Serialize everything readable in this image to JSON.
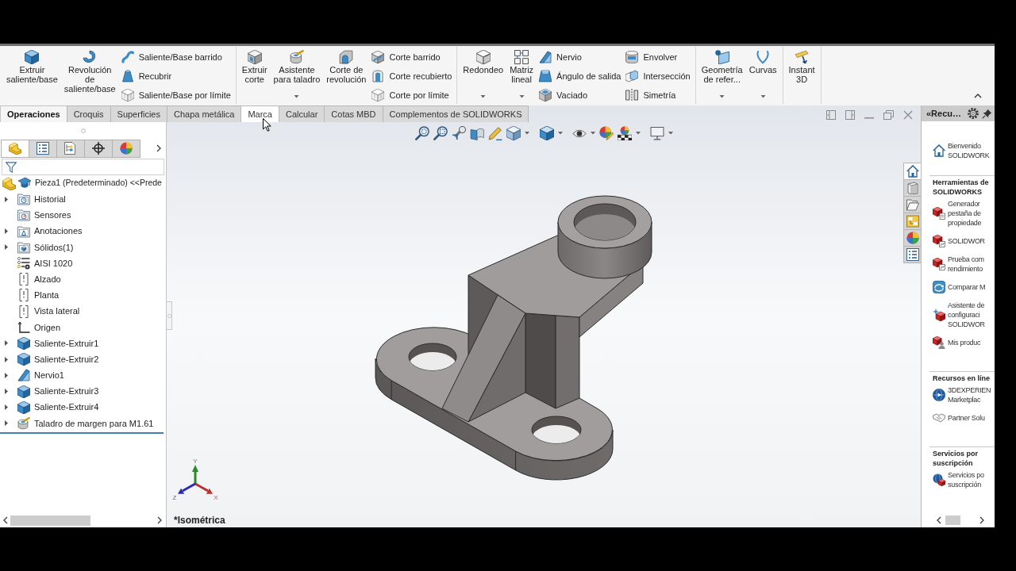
{
  "ribbon": {
    "groups": [
      {
        "items": [
          {
            "kind": "large",
            "label": "Extruir\nsaliente/base",
            "dropdown": false
          },
          {
            "kind": "large",
            "label": "Revolución\nde\nsaliente/base",
            "dropdown": false
          },
          {
            "kind": "stack",
            "commands": [
              "Saliente/Base barrido",
              "Recubrir",
              "Saliente/Base por límite"
            ]
          }
        ]
      },
      {
        "items": [
          {
            "kind": "large",
            "label": "Extruir\ncorte",
            "dropdown": false
          },
          {
            "kind": "large",
            "label": "Asistente\npara taladro",
            "dropdown": true
          },
          {
            "kind": "large",
            "label": "Corte de\nrevolución",
            "dropdown": false
          },
          {
            "kind": "stack",
            "commands": [
              "Corte barrido",
              "Corte recubierto",
              "Corte por límite"
            ]
          }
        ]
      },
      {
        "items": [
          {
            "kind": "large",
            "label": "Redondeo",
            "dropdown": true
          },
          {
            "kind": "large",
            "label": "Matriz\nlineal",
            "dropdown": true
          },
          {
            "kind": "stack",
            "commands": [
              "Nervio",
              "Ángulo de salida",
              "Vaciado"
            ]
          },
          {
            "kind": "stack",
            "commands": [
              "Envolver",
              "Intersección",
              "Simetría"
            ]
          }
        ]
      },
      {
        "items": [
          {
            "kind": "large",
            "label": "Geometría\nde refer...",
            "dropdown": true
          },
          {
            "kind": "large",
            "label": "Curvas",
            "dropdown": true
          }
        ]
      },
      {
        "items": [
          {
            "kind": "large",
            "label": "Instant\n3D",
            "dropdown": false
          }
        ]
      }
    ]
  },
  "tabs": [
    {
      "label": "Operaciones",
      "selected": true,
      "hovered": false
    },
    {
      "label": "Croquis",
      "selected": false,
      "hovered": false
    },
    {
      "label": "Superficies",
      "selected": false,
      "hovered": false
    },
    {
      "label": "Chapa metálica",
      "selected": false,
      "hovered": false
    },
    {
      "label": "Marca",
      "selected": false,
      "hovered": true
    },
    {
      "label": "Calcular",
      "selected": false,
      "hovered": false
    },
    {
      "label": "Cotas MBD",
      "selected": false,
      "hovered": false
    },
    {
      "label": "Complementos de SOLIDWORKS",
      "selected": false,
      "hovered": false
    }
  ],
  "feature_manager": {
    "tabs": [
      {
        "selected": true
      },
      {
        "selected": false
      },
      {
        "selected": false
      },
      {
        "selected": false
      },
      {
        "selected": false
      }
    ],
    "tree": {
      "label": "Pieza1 (Predeterminado) <<Prede",
      "children": [
        {
          "label": "Historial",
          "expandable": true
        },
        {
          "label": "Sensores",
          "expandable": false
        },
        {
          "label": "Anotaciones",
          "expandable": true
        },
        {
          "label": "Sólidos(1)",
          "expandable": true
        },
        {
          "label": "AISI 1020",
          "expandable": false
        },
        {
          "label": "Alzado",
          "expandable": false
        },
        {
          "label": "Planta",
          "expandable": false
        },
        {
          "label": "Vista lateral",
          "expandable": false
        },
        {
          "label": "Origen",
          "expandable": false
        },
        {
          "label": "Saliente-Extruir1",
          "expandable": true
        },
        {
          "label": "Saliente-Extruir2",
          "expandable": true
        },
        {
          "label": "Nervio1",
          "expandable": true
        },
        {
          "label": "Saliente-Extruir3",
          "expandable": true
        },
        {
          "label": "Saliente-Extruir4",
          "expandable": true
        },
        {
          "label": "Taladro de margen para M1.61",
          "expandable": true
        }
      ]
    }
  },
  "viewport": {
    "view_name": "*Isométrica",
    "triad": {
      "y": "Y",
      "x": "X",
      "z": "Z"
    }
  },
  "task_pane": {
    "title": "«Recu…",
    "tabs": [
      {
        "selected": true
      },
      {
        "selected": false
      },
      {
        "selected": false
      },
      {
        "selected": false
      },
      {
        "selected": false
      },
      {
        "selected": false
      }
    ],
    "welcome": "Bienvenido\nSOLIDWORK",
    "sections": [
      {
        "heading": "Herramientas de\nSOLIDWORKS",
        "items": [
          "Generador\npestaña de\npropiedade",
          "SOLIDWOR",
          "Prueba com\nrendimiento",
          "Comparar M",
          "Asistente de\nconfiguraci\nSOLIDWOR",
          "Mis produc"
        ]
      },
      {
        "heading": "Recursos en líne",
        "items": [
          "3DEXPERIEN\nMarketplac",
          "Partner Solu"
        ]
      },
      {
        "heading": "Servicios por\nsuscripción",
        "items": [
          "Servicios po\nsuscripción"
        ]
      }
    ]
  }
}
